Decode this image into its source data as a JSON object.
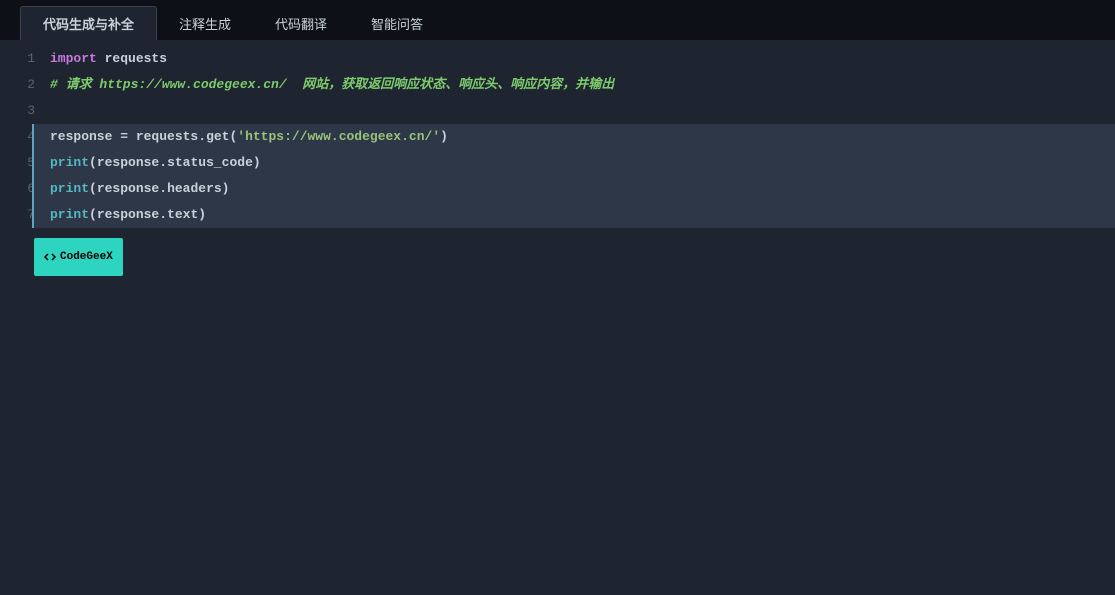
{
  "tabs": [
    {
      "label": "代码生成与补全",
      "active": true
    },
    {
      "label": "注释生成",
      "active": false
    },
    {
      "label": "代码翻译",
      "active": false
    },
    {
      "label": "智能问答",
      "active": false
    }
  ],
  "lineNumbers": [
    "1",
    "2",
    "3",
    "4",
    "5",
    "6",
    "7"
  ],
  "code": {
    "line1": {
      "kw": "import",
      "mod": " requests"
    },
    "line2": {
      "comment": "# 请求 https://www.codegeex.cn/  网站，获取返回响应状态、响应头、响应内容，并输出"
    },
    "line3": {
      "empty": ""
    },
    "line4": {
      "var": "response ",
      "op": "= ",
      "mod2": "requests",
      "dot": ".",
      "func": "get",
      "p1": "(",
      "str": "'https://www.codegeex.cn/'",
      "p2": ")"
    },
    "line5": {
      "func": "print",
      "p1": "(",
      "arg": "response",
      "dot": ".",
      "prop": "status_code",
      "p2": ")"
    },
    "line6": {
      "func": "print",
      "p1": "(",
      "arg": "response",
      "dot": ".",
      "prop": "headers",
      "p2": ")"
    },
    "line7": {
      "func": "print",
      "p1": "(",
      "arg": "response",
      "dot": ".",
      "prop": "text",
      "p2": ")"
    }
  },
  "badge": {
    "label": "CodeGeeX"
  }
}
